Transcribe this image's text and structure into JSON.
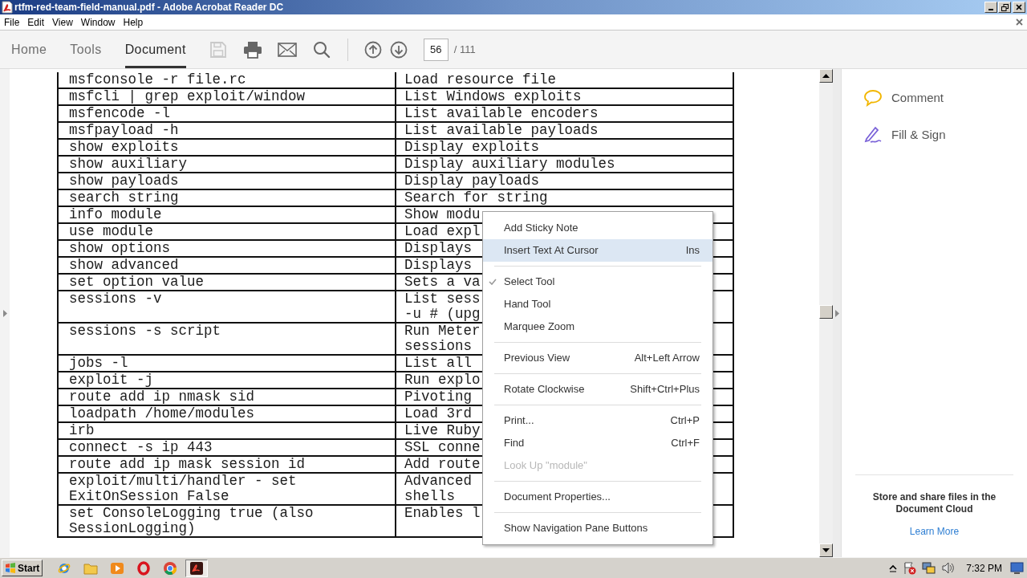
{
  "window": {
    "title": "rtfm-red-team-field-manual.pdf - Adobe Acrobat Reader DC"
  },
  "menu_bar": [
    "File",
    "Edit",
    "View",
    "Window",
    "Help"
  ],
  "toolbar": {
    "tabs": [
      {
        "label": "Home",
        "selected": false
      },
      {
        "label": "Tools",
        "selected": false
      },
      {
        "label": "Document",
        "selected": true
      }
    ],
    "file_tools": [
      {
        "kind": "save",
        "disabled": true
      },
      {
        "kind": "print",
        "disabled": false
      },
      {
        "kind": "email",
        "disabled": false
      },
      {
        "kind": "search",
        "disabled": false
      }
    ],
    "page_nav": {
      "buttons": [
        {
          "kind": "previous_page"
        },
        {
          "kind": "next_page"
        }
      ],
      "page": "56",
      "total": "/ 111"
    }
  },
  "document": {
    "rows": [
      {
        "command": "msfconsole -r file.rc",
        "description": "Load resource file"
      },
      {
        "command": "msfcli | grep exploit/window",
        "description": "List Windows exploits"
      },
      {
        "command": "msfencode -l",
        "description": "List available encoders"
      },
      {
        "command": "msfpayload -h",
        "description": "List available payloads"
      },
      {
        "command": "show exploits",
        "description": "Display exploits"
      },
      {
        "command": "show auxiliary",
        "description": "Display auxiliary modules"
      },
      {
        "command": "show payloads",
        "description": "Display payloads"
      },
      {
        "command": "search string",
        "description": "Search for string"
      },
      {
        "command": "info module",
        "description": "Show modu"
      },
      {
        "command": "use module",
        "description": "Load expl"
      },
      {
        "command": "show options",
        "description": "Displays"
      },
      {
        "command": "show advanced",
        "description": "Displays"
      },
      {
        "command": "set option value",
        "description": "Sets a va"
      },
      {
        "command": "sessions -v",
        "description": "List sess\n-u # (upg"
      },
      {
        "command": "sessions -s script",
        "description": "Run Meter\nsessions"
      },
      {
        "command": "jobs -l",
        "description": "List all"
      },
      {
        "command": "exploit -j",
        "description": "Run explo"
      },
      {
        "command": "route add ip nmask sid",
        "description": "Pivoting"
      },
      {
        "command": "loadpath /home/modules",
        "description": "Load 3rd"
      },
      {
        "command": "irb",
        "description": "Live Ruby"
      },
      {
        "command": "connect -s ip 443",
        "description": "SSL conne"
      },
      {
        "command": "route add ip mask session id",
        "description": "Add route"
      },
      {
        "command": "exploit/multi/handler - set\nExitOnSession False",
        "description": "Advanced\nshells"
      },
      {
        "command": "set ConsoleLogging true (also\nSessionLogging)",
        "description": "Enables l"
      }
    ]
  },
  "context_menu": {
    "items": [
      {
        "kind": "item",
        "label": "Add Sticky Note",
        "highlighted": false,
        "checked": false,
        "disabled": false
      },
      {
        "kind": "item",
        "label": "Insert Text At Cursor",
        "shortcut": "Ins",
        "highlighted": true,
        "checked": false,
        "disabled": false
      },
      {
        "kind": "separator"
      },
      {
        "kind": "item",
        "label": "Select Tool",
        "highlighted": false,
        "checked": true,
        "disabled": false
      },
      {
        "kind": "item",
        "label": "Hand Tool",
        "highlighted": false,
        "checked": false,
        "disabled": false
      },
      {
        "kind": "item",
        "label": "Marquee Zoom",
        "highlighted": false,
        "checked": false,
        "disabled": false
      },
      {
        "kind": "separator"
      },
      {
        "kind": "item",
        "label": "Previous View",
        "shortcut": "Alt+Left Arrow",
        "highlighted": false,
        "checked": false,
        "disabled": false
      },
      {
        "kind": "separator"
      },
      {
        "kind": "item",
        "label": "Rotate Clockwise",
        "shortcut": "Shift+Ctrl+Plus",
        "highlighted": false,
        "checked": false,
        "disabled": false
      },
      {
        "kind": "separator"
      },
      {
        "kind": "item",
        "label": "Print...",
        "shortcut": "Ctrl+P",
        "highlighted": false,
        "checked": false,
        "disabled": false
      },
      {
        "kind": "item",
        "label": "Find",
        "shortcut": "Ctrl+F",
        "highlighted": false,
        "checked": false,
        "disabled": false
      },
      {
        "kind": "item",
        "label": "Look Up \"module\"",
        "highlighted": false,
        "checked": false,
        "disabled": true
      },
      {
        "kind": "separator"
      },
      {
        "kind": "item",
        "label": "Document Properties...",
        "highlighted": false,
        "checked": false,
        "disabled": false
      },
      {
        "kind": "separator"
      },
      {
        "kind": "item",
        "label": "Show Navigation Pane Buttons",
        "highlighted": false,
        "checked": false,
        "disabled": false
      }
    ]
  },
  "right_pane": {
    "tools": [
      {
        "kind": "comment",
        "label": "Comment"
      },
      {
        "kind": "fill_sign",
        "label": "Fill & Sign"
      }
    ],
    "promo": {
      "text": "Store and share files in the Document Cloud",
      "link": "Learn More"
    }
  },
  "taskbar": {
    "start": "Start",
    "apps": [
      {
        "kind": "internet_explorer",
        "active": false
      },
      {
        "kind": "file_explorer",
        "active": false
      },
      {
        "kind": "media_player",
        "active": false
      },
      {
        "kind": "opera",
        "active": false
      },
      {
        "kind": "chrome",
        "active": false
      },
      {
        "kind": "acrobat",
        "active": true
      }
    ],
    "tray": [
      {
        "kind": "show_hidden"
      },
      {
        "kind": "action_center"
      },
      {
        "kind": "network"
      },
      {
        "kind": "volume"
      }
    ],
    "clock": "7:32 PM"
  }
}
